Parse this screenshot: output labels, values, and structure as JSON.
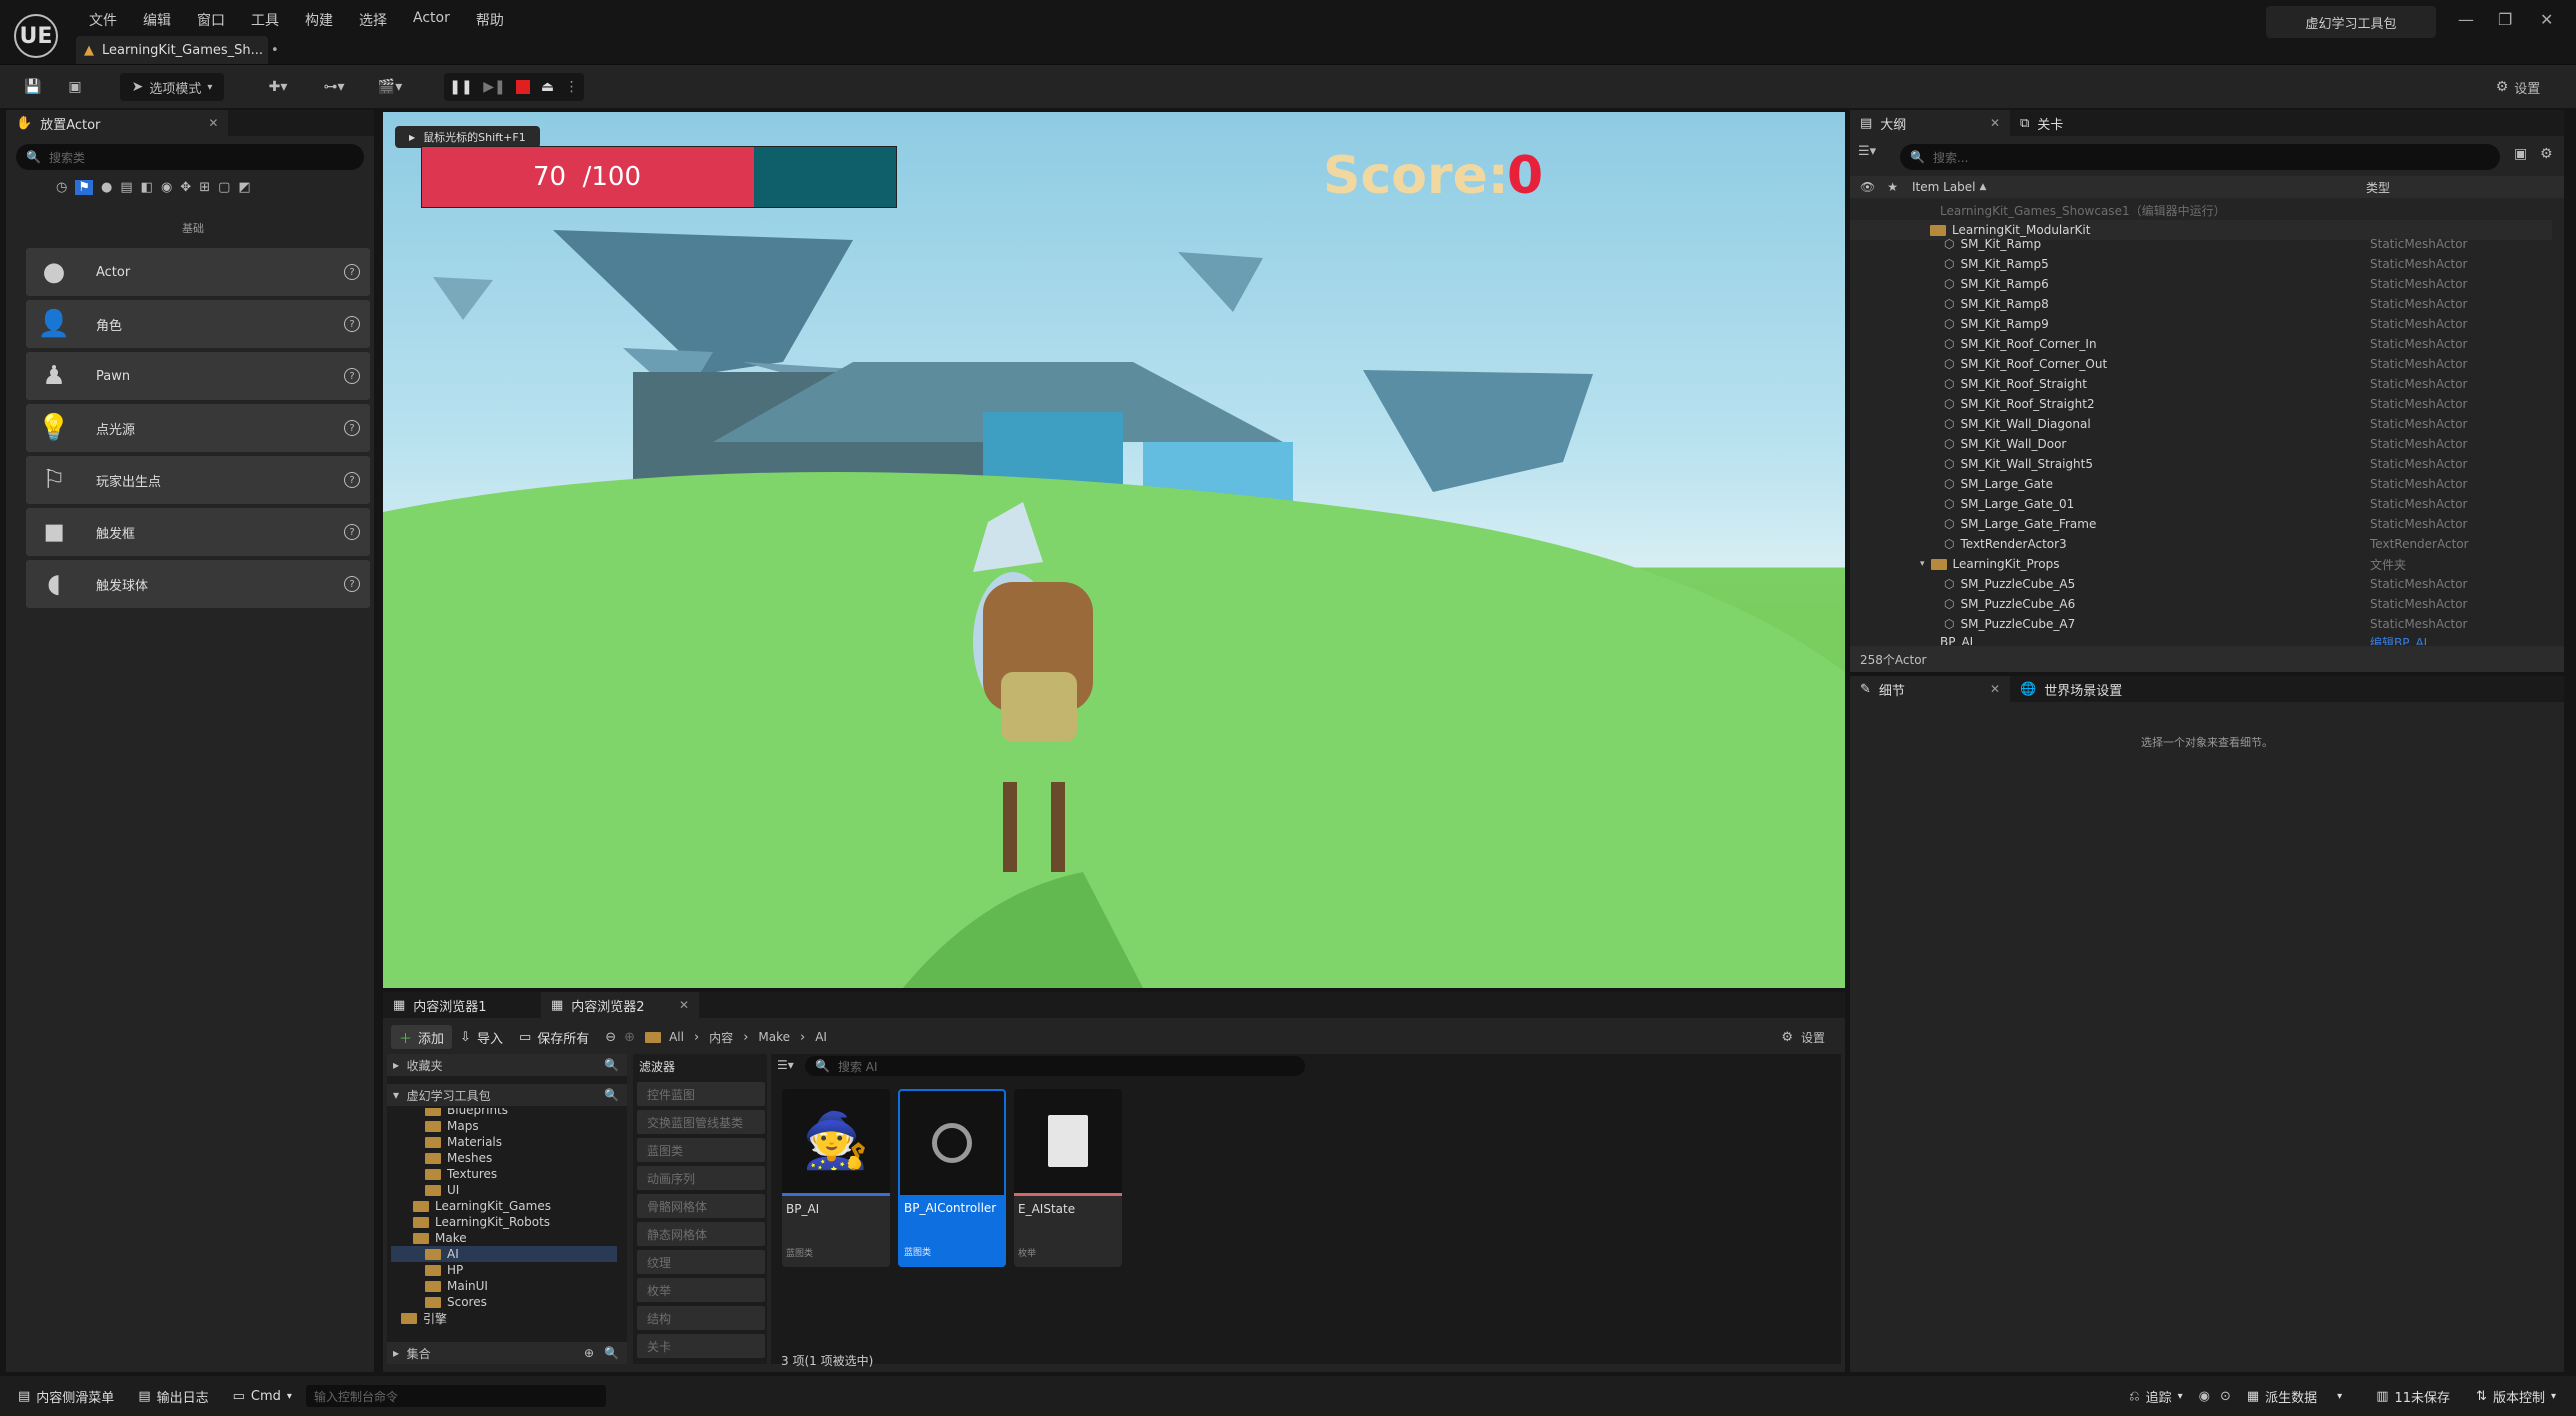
{
  "app": {
    "logo": "UE",
    "menu": [
      "文件",
      "编辑",
      "窗口",
      "工具",
      "构建",
      "选择",
      "Actor",
      "帮助"
    ],
    "doc_tab": "LearningKit_Games_Sh...",
    "window_title": "虚幻学习工具包"
  },
  "toolbar": {
    "mode_label": "选项模式",
    "settings_label": "设置"
  },
  "place_actors": {
    "tab_label": "放置Actor",
    "search_placeholder": "搜索类",
    "category_label": "基础",
    "items": [
      {
        "label": "Actor",
        "icon": "sphere-icon"
      },
      {
        "label": "角色",
        "icon": "character-icon"
      },
      {
        "label": "Pawn",
        "icon": "pawn-icon"
      },
      {
        "label": "点光源",
        "icon": "point-light-icon"
      },
      {
        "label": "玩家出生点",
        "icon": "player-start-icon"
      },
      {
        "label": "触发框",
        "icon": "trigger-box-icon"
      },
      {
        "label": "触发球体",
        "icon": "trigger-sphere-icon"
      }
    ]
  },
  "viewport": {
    "hint": "鼠标光标的Shift+F1",
    "health_text": "70  /100",
    "health_fraction": 0.7,
    "score_label": "Score:",
    "score_value": "0",
    "colors": {
      "health": "#dd3650",
      "health_bg": "#0f5f6a",
      "score_label": "#f1d8a0",
      "score_value": "#e8213a"
    }
  },
  "outliner": {
    "tabs": [
      "大纲",
      "关卡"
    ],
    "search_placeholder": "搜索...",
    "col_label": "Item Label",
    "col_type": "类型",
    "level_row": "LearningKit_Games_Showcase1（编辑器中运行）",
    "folder_row": "LearningKit_ModularKit",
    "rows": [
      {
        "label": "SM_Kit_Ramp",
        "type": "StaticMeshActor"
      },
      {
        "label": "SM_Kit_Ramp5",
        "type": "StaticMeshActor"
      },
      {
        "label": "SM_Kit_Ramp6",
        "type": "StaticMeshActor"
      },
      {
        "label": "SM_Kit_Ramp8",
        "type": "StaticMeshActor"
      },
      {
        "label": "SM_Kit_Ramp9",
        "type": "StaticMeshActor"
      },
      {
        "label": "SM_Kit_Roof_Corner_In",
        "type": "StaticMeshActor"
      },
      {
        "label": "SM_Kit_Roof_Corner_Out",
        "type": "StaticMeshActor"
      },
      {
        "label": "SM_Kit_Roof_Straight",
        "type": "StaticMeshActor"
      },
      {
        "label": "SM_Kit_Roof_Straight2",
        "type": "StaticMeshActor"
      },
      {
        "label": "SM_Kit_Wall_Diagonal",
        "type": "StaticMeshActor"
      },
      {
        "label": "SM_Kit_Wall_Door",
        "type": "StaticMeshActor"
      },
      {
        "label": "SM_Kit_Wall_Straight5",
        "type": "StaticMeshActor"
      },
      {
        "label": "SM_Large_Gate",
        "type": "StaticMeshActor"
      },
      {
        "label": "SM_Large_Gate_01",
        "type": "StaticMeshActor"
      },
      {
        "label": "SM_Large_Gate_Frame",
        "type": "StaticMeshActor"
      },
      {
        "label": "TextRenderActor3",
        "type": "TextRenderActor"
      }
    ],
    "props_folder": {
      "label": "LearningKit_Props",
      "type": "文件夹"
    },
    "props_rows": [
      {
        "label": "SM_PuzzleCube_A5",
        "type": "StaticMeshActor"
      },
      {
        "label": "SM_PuzzleCube_A6",
        "type": "StaticMeshActor"
      },
      {
        "label": "SM_PuzzleCube_A7",
        "type": "StaticMeshActor"
      }
    ],
    "last_row": {
      "label": "BP_AI",
      "type": "编辑BP_AI"
    },
    "count": "258个Actor"
  },
  "details": {
    "tabs": [
      "细节",
      "世界场景设置"
    ],
    "empty_text": "选择一个对象来查看细节。"
  },
  "content_browser": {
    "tabs": [
      "内容浏览器1",
      "内容浏览器2"
    ],
    "add_label": "添加",
    "import_label": "导入",
    "save_all_label": "保存所有",
    "settings_label": "设置",
    "path": [
      "All",
      "内容",
      "Make",
      "AI"
    ],
    "favorites_label": "收藏夹",
    "project_label": "虚幻学习工具包",
    "filters_label": "滤波器",
    "filters": [
      "控件蓝图",
      "交换蓝图管线基类",
      "蓝图类",
      "动画序列",
      "骨骼网格体",
      "静态网格体",
      "纹理",
      "枚举",
      "结构",
      "关卡"
    ],
    "search_placeholder": "搜索 AI",
    "tree": [
      {
        "label": "Blueprints",
        "depth": 2
      },
      {
        "label": "Maps",
        "depth": 2
      },
      {
        "label": "Materials",
        "depth": 2
      },
      {
        "label": "Meshes",
        "depth": 2
      },
      {
        "label": "Textures",
        "depth": 2
      },
      {
        "label": "UI",
        "depth": 2
      },
      {
        "label": "LearningKit_Games",
        "depth": 1
      },
      {
        "label": "LearningKit_Robots",
        "depth": 1
      },
      {
        "label": "Make",
        "depth": 1
      },
      {
        "label": "AI",
        "depth": 2
      },
      {
        "label": "HP",
        "depth": 2
      },
      {
        "label": "MainUI",
        "depth": 2
      },
      {
        "label": "Scores",
        "depth": 2
      },
      {
        "label": "引擎",
        "depth": 0
      }
    ],
    "collections_label": "集合",
    "assets": [
      {
        "name": "BP_AI",
        "type": "蓝图类"
      },
      {
        "name": "BP_AIController",
        "type": "蓝图类"
      },
      {
        "name": "E_AIState",
        "type": "枚举"
      }
    ],
    "status": "3 项(1 项被选中)"
  },
  "statusbar": {
    "drawer": "内容侧滑菜单",
    "output_log": "输出日志",
    "cmd": "Cmd",
    "console_placeholder": "输入控制台命令",
    "trace": "追踪",
    "derived_data": "派生数据",
    "unsaved": "11未保存",
    "source_control": "版本控制"
  }
}
